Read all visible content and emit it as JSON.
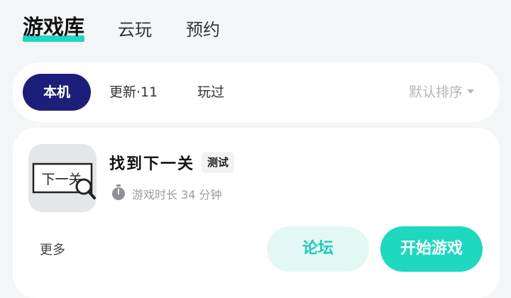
{
  "top_tabs": [
    {
      "label": "游戏库",
      "active": true
    },
    {
      "label": "云玩",
      "active": false
    },
    {
      "label": "预约",
      "active": false
    }
  ],
  "filters": [
    {
      "label": "本机",
      "active": true
    },
    {
      "label": "更新·11",
      "active": false
    },
    {
      "label": "玩过",
      "active": false
    }
  ],
  "sort": {
    "label": "默认排序",
    "icon": "caret-down-icon"
  },
  "game": {
    "icon_text": "下一关",
    "title": "找到下一关",
    "badge": "测试",
    "playtime": "游戏时长 34 分钟",
    "more_label": "更多",
    "forum_label": "论坛",
    "start_label": "开始游戏"
  },
  "colors": {
    "accent": "#1ed8c0",
    "active_filter": "#1b1f7a",
    "forum_bg": "#e3f8f5",
    "page_bg": "#f3f5f7"
  }
}
